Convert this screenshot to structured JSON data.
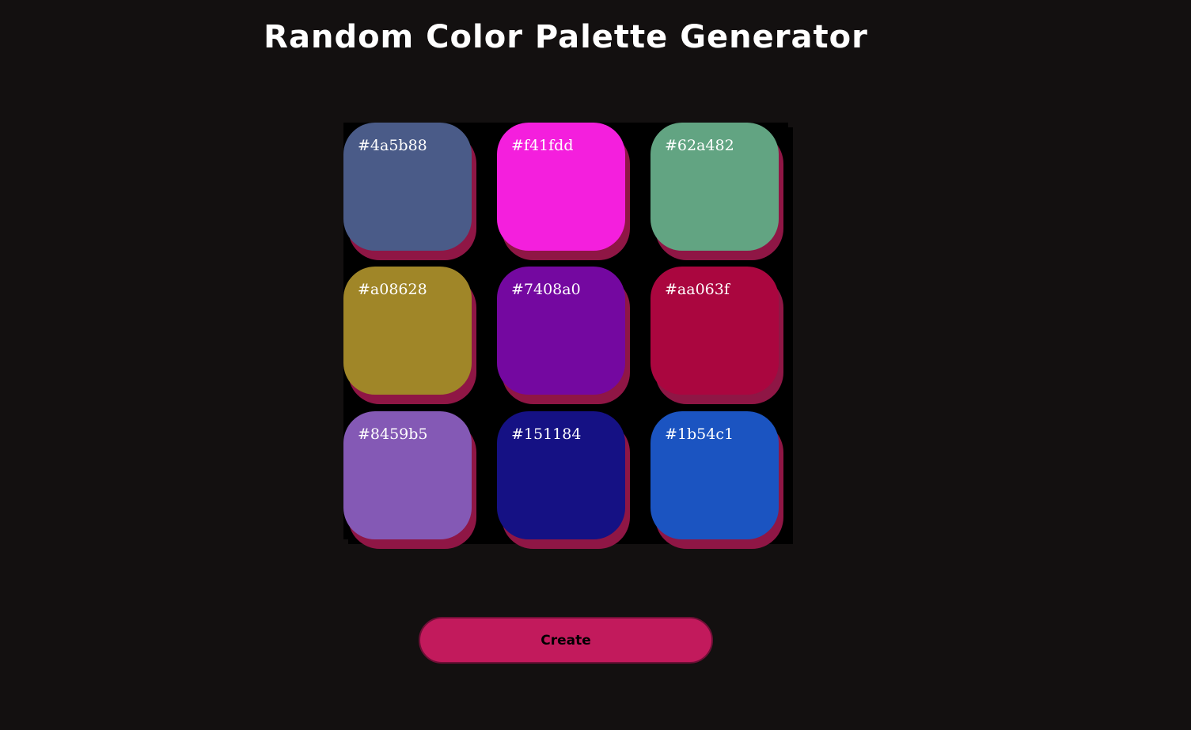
{
  "page": {
    "title": "Random Color Palette Generator"
  },
  "palette": {
    "swatches": [
      {
        "code": "#4a5b88",
        "color": "#4a5b88"
      },
      {
        "code": "#f41fdd",
        "color": "#f41fdd"
      },
      {
        "code": "#62a482",
        "color": "#62a482"
      },
      {
        "code": "#a08628",
        "color": "#a08628"
      },
      {
        "code": "#7408a0",
        "color": "#7408a0"
      },
      {
        "code": "#aa063f",
        "color": "#aa063f"
      },
      {
        "code": "#8459b5",
        "color": "#8459b5"
      },
      {
        "code": "#151184",
        "color": "#151184"
      },
      {
        "code": "#1b54c1",
        "color": "#1b54c1"
      }
    ]
  },
  "actions": {
    "create_label": "Create"
  },
  "colors": {
    "background": "#131010",
    "button": "#c21a5c",
    "swatch_shadow": "#8f1645"
  }
}
